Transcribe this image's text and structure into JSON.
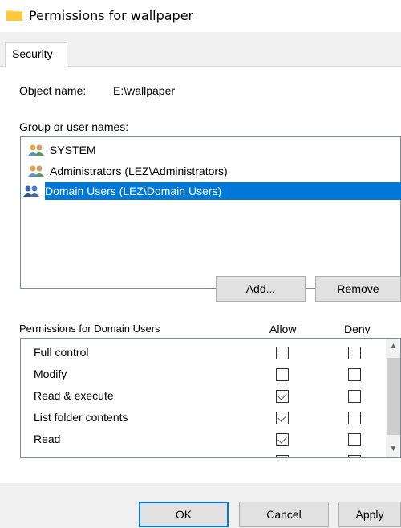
{
  "window": {
    "title": "Permissions for wallpaper"
  },
  "tabs": [
    {
      "label": "Security"
    }
  ],
  "object": {
    "label": "Object name:",
    "value": "E:\\wallpaper"
  },
  "group_label": "Group or user names:",
  "users": [
    {
      "name": "SYSTEM",
      "selected": false
    },
    {
      "name": "Administrators (LEZ\\Administrators)",
      "selected": false
    },
    {
      "name": "Domain Users (LEZ\\Domain Users)",
      "selected": true
    }
  ],
  "buttons": {
    "add": "Add...",
    "remove": "Remove",
    "ok": "OK",
    "cancel": "Cancel",
    "apply": "Apply"
  },
  "permissions": {
    "header": "Permissions for Domain Users",
    "allow_label": "Allow",
    "deny_label": "Deny",
    "rows": [
      {
        "name": "Full control",
        "allow": false,
        "deny": false
      },
      {
        "name": "Modify",
        "allow": false,
        "deny": false
      },
      {
        "name": "Read & execute",
        "allow": true,
        "deny": false
      },
      {
        "name": "List folder contents",
        "allow": true,
        "deny": false
      },
      {
        "name": "Read",
        "allow": true,
        "deny": false
      }
    ]
  },
  "icons": {
    "title": "folder-icon",
    "user": "users-group-icon"
  },
  "colors": {
    "selection": "#0078d7",
    "folder": "#ffd86b",
    "primary_border": "#0078d7"
  }
}
